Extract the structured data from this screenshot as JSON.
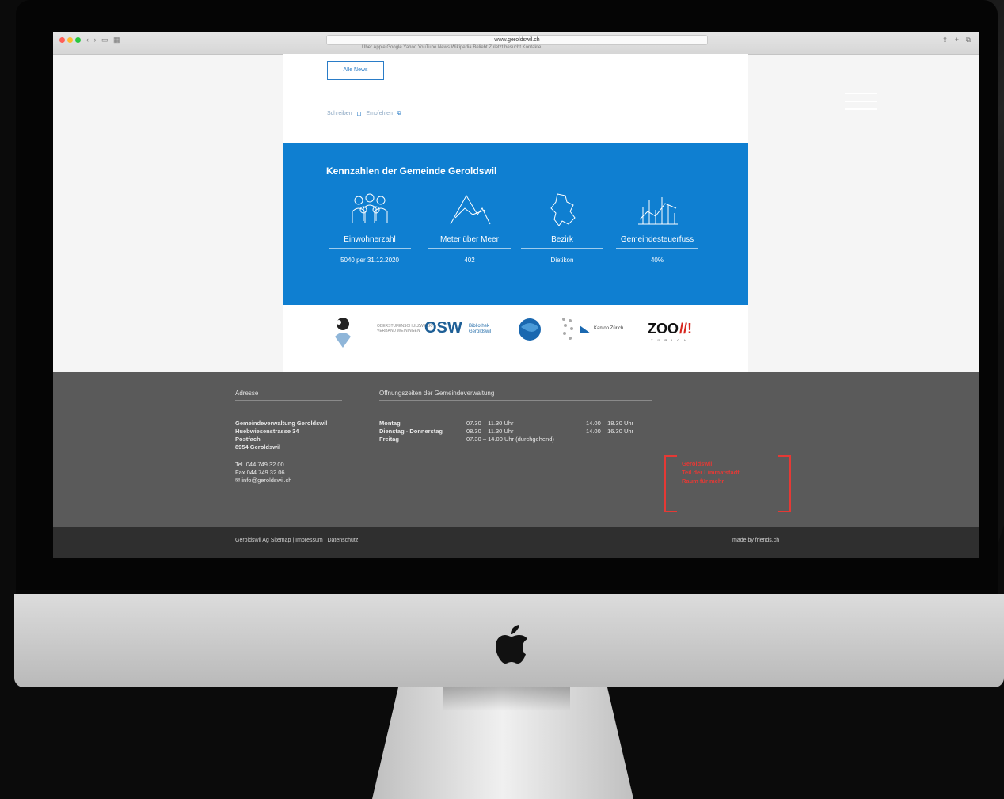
{
  "browser": {
    "url": "www.geroldswil.ch",
    "nav_glyphs": "‹ › ▭ ▦",
    "right_glyphs": "⇪ + ⧉",
    "bookmarks": "Über Apple  Google  Yahoo  YouTube  News  Wikipedia  Beliebt  Zuletzt besucht  Kontakte"
  },
  "news": {
    "button_label": "Alle News",
    "share_1": "Schreiben",
    "share_2": "Empfehlen",
    "share_icon": "⊡",
    "share_icon_2": "⧉"
  },
  "stats": {
    "title": "Kennzahlen der Gemeinde Geroldswil",
    "items": [
      {
        "icon": "people-icon",
        "label": "Einwohnerzahl",
        "value": "5040 per 31.12.2020"
      },
      {
        "icon": "mountain-icon",
        "label": "Meter über Meer",
        "value": "402"
      },
      {
        "icon": "map-outline-icon",
        "label": "Bezirk",
        "value": "Dietikon"
      },
      {
        "icon": "bar-growth-icon",
        "label": "Gemeindesteuerfuss",
        "value": "40%"
      }
    ]
  },
  "logos": {
    "pie": "●",
    "osw": "OSW",
    "osw_sub": "OBERSTUFENSCHULZWECK-\nVERBAND WEININGEN",
    "bib": "Bibliothek\nGeroldswil",
    "kanton": "Kanton Zürich",
    "zoo": "ZOO",
    "zoo_mark": "//!",
    "zoo_sub": "ZÜRICH"
  },
  "footer": {
    "address_heading": "Adresse",
    "hours_heading": "Öffnungszeiten der Gemeindeverwaltung",
    "address_name": "Gemeindeverwaltung Geroldswil",
    "address_street": "Huebwiesenstrasse 34",
    "address_extra": "Postfach",
    "address_city": "8954 Geroldswil",
    "tel": "Tel. 044 749 32 00",
    "fax": "Fax 044 749 32 06",
    "email": "✉ info@geroldswil.ch",
    "hours": [
      {
        "day": "Montag",
        "am": "07.30 – 11.30 Uhr",
        "pm": "14.00 – 18.30 Uhr"
      },
      {
        "day": "Dienstag - Donnerstag",
        "am": "08.30 – 11.30 Uhr",
        "pm": "14.00 – 16.30 Uhr"
      },
      {
        "day": "Freitag",
        "am": "07.30 – 14.00 Uhr (durchgehend)",
        "pm": ""
      }
    ],
    "claim_1": "Geroldswil",
    "claim_2": "Teil der Limmatstadt",
    "claim_3": "Raum für mehr"
  },
  "subfooter": {
    "left": "Geroldswil Ag     Sitemap   |   Impressum   |   Datenschutz",
    "right": "made by friends.ch"
  },
  "colors": {
    "stats_bg": "#0f7fd1",
    "footer_bg": "#5a5a5a",
    "claim_red": "#e53935"
  }
}
